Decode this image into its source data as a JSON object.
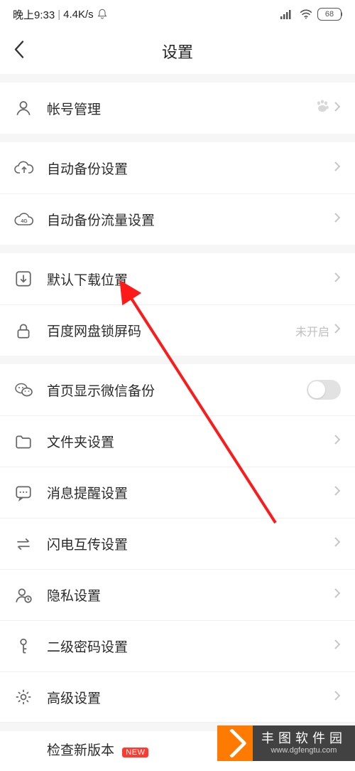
{
  "status": {
    "time": "晚上9:33",
    "speed": "4.4K/s",
    "battery": "68"
  },
  "header": {
    "title": "设置"
  },
  "rows": {
    "account": {
      "label": "帐号管理"
    },
    "backup": {
      "label": "自动备份设置"
    },
    "backup4g": {
      "label": "自动备份流量设置"
    },
    "download": {
      "label": "默认下载位置"
    },
    "lock": {
      "label": "百度网盘锁屏码",
      "note": "未开启"
    },
    "wechat": {
      "label": "首页显示微信备份"
    },
    "folder": {
      "label": "文件夹设置"
    },
    "notify": {
      "label": "消息提醒设置"
    },
    "flash": {
      "label": "闪电互传设置"
    },
    "privacy": {
      "label": "隐私设置"
    },
    "secondpw": {
      "label": "二级密码设置"
    },
    "advanced": {
      "label": "高级设置"
    },
    "update": {
      "label": "检查新版本",
      "badge": "NEW"
    }
  },
  "watermark": {
    "cn": "丰图软件园",
    "url": "www.dgfengtu.com"
  }
}
